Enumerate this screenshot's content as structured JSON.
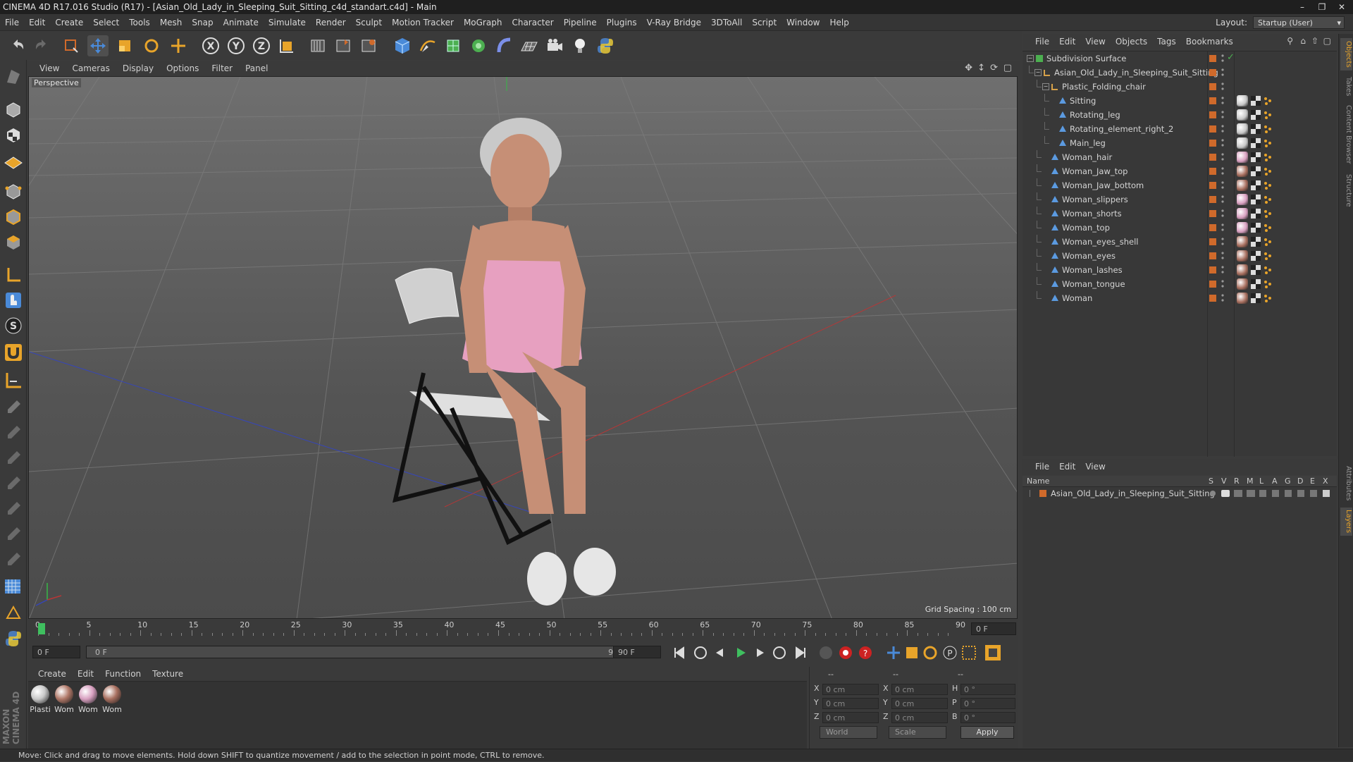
{
  "window": {
    "title": "CINEMA 4D R17.016 Studio (R17) - [Asian_Old_Lady_in_Sleeping_Suit_Sitting_c4d_standart.c4d] - Main"
  },
  "menu": [
    "File",
    "Edit",
    "Create",
    "Select",
    "Tools",
    "Mesh",
    "Snap",
    "Animate",
    "Simulate",
    "Render",
    "Sculpt",
    "Motion Tracker",
    "MoGraph",
    "Character",
    "Pipeline",
    "Plugins",
    "V-Ray Bridge",
    "3DToAll",
    "Script",
    "Window",
    "Help"
  ],
  "layout": {
    "label": "Layout:",
    "value": "Startup (User)"
  },
  "viewport": {
    "menu": [
      "View",
      "Cameras",
      "Display",
      "Options",
      "Filter",
      "Panel"
    ],
    "camera_label": "Perspective",
    "grid_spacing": "Grid Spacing : 100 cm"
  },
  "timeline": {
    "ticks": [
      "0",
      "5",
      "10",
      "15",
      "20",
      "25",
      "30",
      "35",
      "40",
      "45",
      "50",
      "55",
      "60",
      "65",
      "70",
      "75",
      "80",
      "85",
      "90"
    ],
    "current_frame": "0 F",
    "start_frame": "0 F",
    "range_start": "0 F",
    "range_end": "90 F",
    "end_frame": "90 F",
    "playhead_fraction": 0.0
  },
  "materials": {
    "menu": [
      "Create",
      "Edit",
      "Function",
      "Texture"
    ],
    "items": [
      {
        "label": "Plasti",
        "color": "#c8c8c8"
      },
      {
        "label": "Wom",
        "color": "#b07868"
      },
      {
        "label": "Wom",
        "color": "#d8a0c0"
      },
      {
        "label": "Wom",
        "color": "#a86f5f"
      }
    ]
  },
  "coordinates": {
    "header": [
      "--",
      "--",
      "--"
    ],
    "rows": [
      {
        "a_label": "X",
        "a_value": "0 cm",
        "b_label": "X",
        "b_value": "0 cm",
        "c_label": "H",
        "c_value": "0 °"
      },
      {
        "a_label": "Y",
        "a_value": "0 cm",
        "b_label": "Y",
        "b_value": "0 cm",
        "c_label": "P",
        "c_value": "0 °"
      },
      {
        "a_label": "Z",
        "a_value": "0 cm",
        "b_label": "Z",
        "b_value": "0 cm",
        "c_label": "B",
        "c_value": "0 °"
      }
    ],
    "mode_world": "World",
    "mode_scale": "Scale",
    "apply": "Apply"
  },
  "status": "Move: Click and drag to move elements. Hold down SHIFT to quantize movement / add to the selection in point mode, CTRL to remove.",
  "objects": {
    "menu": [
      "File",
      "Edit",
      "View",
      "Objects",
      "Tags",
      "Bookmarks"
    ],
    "rows": [
      {
        "name": "Subdivision Surface",
        "indent": 0,
        "icon": "subdivision-icon"
      },
      {
        "name": "Asian_Old_Lady_in_Sleeping_Suit_Sitting",
        "indent": 1,
        "icon": "null-icon"
      },
      {
        "name": "Plastic_Folding_chair",
        "indent": 2,
        "icon": "null-icon"
      },
      {
        "name": "Sitting",
        "indent": 3,
        "icon": "mesh-icon",
        "tag": "#c8c8c8"
      },
      {
        "name": "Rotating_leg",
        "indent": 3,
        "icon": "mesh-icon",
        "tag": "#c8c8c8"
      },
      {
        "name": "Rotating_element_right_2",
        "indent": 3,
        "icon": "mesh-icon",
        "tag": "#c8c8c8"
      },
      {
        "name": "Main_leg",
        "indent": 3,
        "icon": "mesh-icon",
        "tag": "#c8c8c8"
      },
      {
        "name": "Woman_hair",
        "indent": 2,
        "icon": "mesh-icon",
        "tag": "#d8a0c0"
      },
      {
        "name": "Woman_Jaw_top",
        "indent": 2,
        "icon": "mesh-icon",
        "tag": "#a86f5f"
      },
      {
        "name": "Woman_Jaw_bottom",
        "indent": 2,
        "icon": "mesh-icon",
        "tag": "#a86f5f"
      },
      {
        "name": "Woman_slippers",
        "indent": 2,
        "icon": "mesh-icon",
        "tag": "#d8a0c0"
      },
      {
        "name": "Woman_shorts",
        "indent": 2,
        "icon": "mesh-icon",
        "tag": "#d8a0c0"
      },
      {
        "name": "Woman_top",
        "indent": 2,
        "icon": "mesh-icon",
        "tag": "#d8a0c0"
      },
      {
        "name": "Woman_eyes_shell",
        "indent": 2,
        "icon": "mesh-icon",
        "tag": "#a86f5f"
      },
      {
        "name": "Woman_eyes",
        "indent": 2,
        "icon": "mesh-icon",
        "tag": "#a86f5f"
      },
      {
        "name": "Woman_lashes",
        "indent": 2,
        "icon": "mesh-icon",
        "tag": "#a86f5f"
      },
      {
        "name": "Woman_tongue",
        "indent": 2,
        "icon": "mesh-icon",
        "tag": "#a86f5f"
      },
      {
        "name": "Woman",
        "indent": 2,
        "icon": "mesh-icon",
        "tag": "#a86f5f"
      }
    ]
  },
  "layers": {
    "menu": [
      "File",
      "Edit",
      "View"
    ],
    "columns": [
      "Name",
      "S",
      "V",
      "R",
      "M",
      "L",
      "A",
      "G",
      "D",
      "E",
      "X"
    ],
    "rows": [
      {
        "name": "Asian_Old_Lady_in_Sleeping_Suit_Sitting",
        "color": "#d06a2b"
      }
    ]
  },
  "side_tabs": [
    "Objects",
    "Takes",
    "Content Browser",
    "Structure",
    "Attributes",
    "Layers"
  ],
  "colors": {
    "accent_orange": "#d06a2b",
    "accent_blue": "#4a8ad8"
  }
}
